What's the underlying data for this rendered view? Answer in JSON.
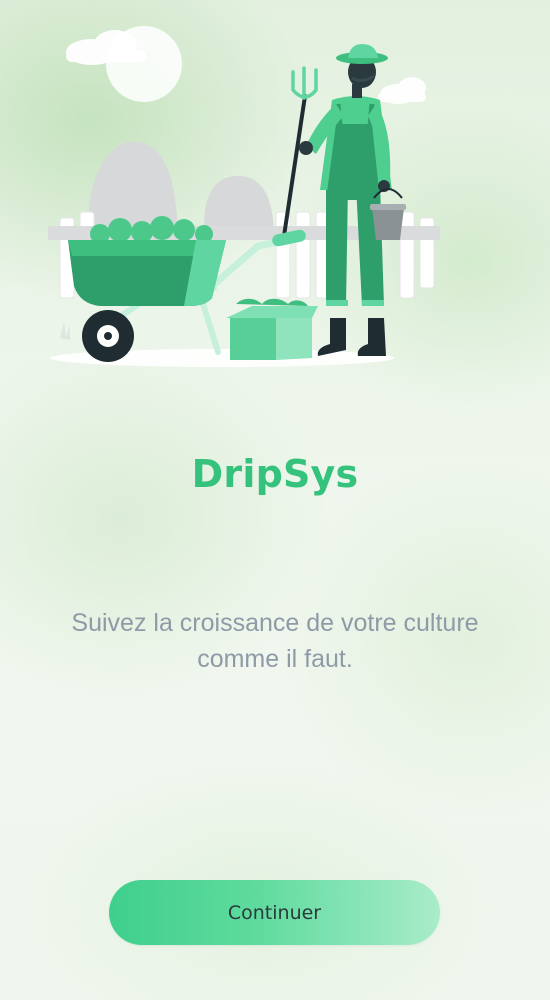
{
  "app": {
    "title": "DripSys",
    "tagline": "Suivez la croissance de votre culture comme il faut."
  },
  "actions": {
    "continue_label": "Continuer"
  },
  "illustration": {
    "subject": "farmer-with-pitchfork-wheelbarrow-and-crate"
  },
  "colors": {
    "accent": "#34c27c",
    "button_start": "#3fcf8c",
    "button_end": "#a9ecc9",
    "tagline": "#8e9aa6",
    "label": "#2b3a3a"
  }
}
